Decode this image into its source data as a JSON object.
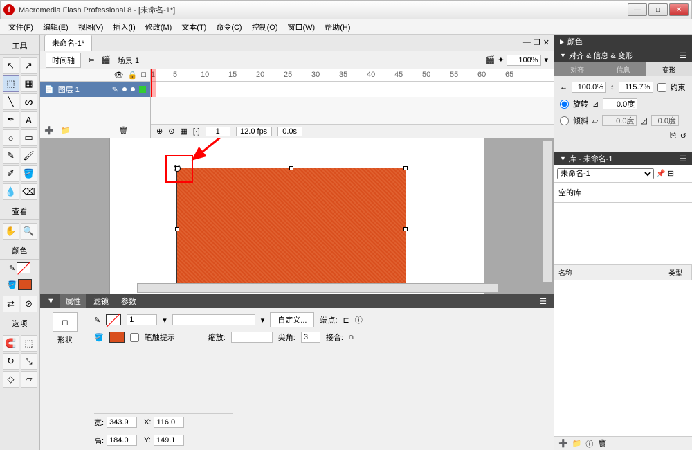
{
  "titlebar": {
    "title": "Macromedia Flash Professional 8 - [未命名-1*]"
  },
  "menu": [
    "文件(F)",
    "编辑(E)",
    "视图(V)",
    "插入(I)",
    "修改(M)",
    "文本(T)",
    "命令(C)",
    "控制(O)",
    "窗口(W)",
    "帮助(H)"
  ],
  "toolbox": {
    "header": "工具",
    "view_hdr": "查看",
    "color_hdr": "颜色",
    "options_hdr": "选项"
  },
  "document": {
    "tab": "未命名-1*",
    "timeline_btn": "时间轴",
    "scene": "场景 1",
    "zoom": "100%"
  },
  "timeline": {
    "layer": "图层 1",
    "frames": [
      "1",
      "5",
      "10",
      "15",
      "20",
      "25",
      "30",
      "35",
      "40",
      "45",
      "50",
      "55",
      "60",
      "65"
    ],
    "cur_frame": "1",
    "fps": "12.0 fps",
    "time": "0.0s"
  },
  "props": {
    "tabs": [
      "属性",
      "滤镜",
      "参数"
    ],
    "shape_label": "形状",
    "stroke_hint": "笔触提示",
    "scale_lbl": "缩放:",
    "custom_btn": "自定义...",
    "cap_lbl": "端点:",
    "miter_lbl": "尖角:",
    "miter_val": "3",
    "join_lbl": "接合:",
    "stroke_w": "1",
    "w_lbl": "宽:",
    "w_val": "343.9",
    "h_lbl": "高:",
    "h_val": "184.0",
    "x_lbl": "X:",
    "x_val": "116.0",
    "y_lbl": "Y:",
    "y_val": "149.1"
  },
  "right": {
    "color_hdr": "颜色",
    "align_hdr": "对齐 & 信息 & 变形",
    "subtabs": [
      "对齐",
      "信息",
      "变形"
    ],
    "tf_w": "100.0%",
    "tf_h": "115.7%",
    "constrain": "约束",
    "rotate": "旋转",
    "rotate_val": "0.0度",
    "skew": "倾斜",
    "skew_h": "0.0度",
    "skew_v": "0.0度",
    "lib_hdr": "库 - 未命名-1",
    "lib_doc": "未命名-1",
    "lib_empty": "空的库",
    "lib_cols": [
      "名称",
      "类型"
    ]
  }
}
